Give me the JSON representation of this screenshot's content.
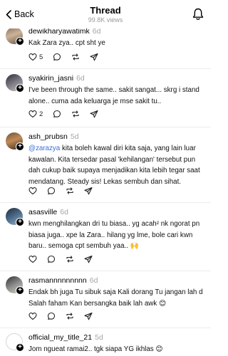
{
  "header": {
    "back_label": "Back",
    "title": "Thread",
    "views": "99.8K views"
  },
  "posts": [
    {
      "username": "dewikharyawatimk",
      "time": "6d",
      "text": "Kak Zara zya.. cpt sht ye",
      "likes": "5",
      "comments": ""
    },
    {
      "username": "syakirin_jasni",
      "time": "6d",
      "text": "I've been through the same.. sakit sangat... skrg i stand alone.. cuma ada keluarga je mse sakit tu..",
      "likes": "2",
      "comments": ""
    },
    {
      "username": "ash_prubsn",
      "time": "5d",
      "mention": "@zarazya",
      "text": " kita boleh kawal diri kita saja, yang lain luar kawalan. Kita tersedar pasal 'kehilangan' tersebut pun dah cukup baik supaya menjadikan kita lebih tegar saat mendatang. Steady sis! Lekas sembuh dan sihat."
    },
    {
      "username": "asasville",
      "time": "6d",
      "text": "kwn menghilangkan dri tu biasa.. yg acah² nk ngorat pn biasa juga.. xpe la Zara.. hilang yg lme, bole cari kwn baru.. semoga cpt sembuh yaa.. 🙌"
    },
    {
      "username": "rasmannnnnnnnn",
      "time": "6d",
      "text": "Endak bh juga Tu sibuk saja Kali dorang Tu jangan lah d Salah faham Kan bersangka baik lah awk 😊"
    },
    {
      "username": "official_my_title_21",
      "time": "5d",
      "text": "Jom ngueat ramai2.. tgk siapa YG ikhlas 😊"
    }
  ]
}
